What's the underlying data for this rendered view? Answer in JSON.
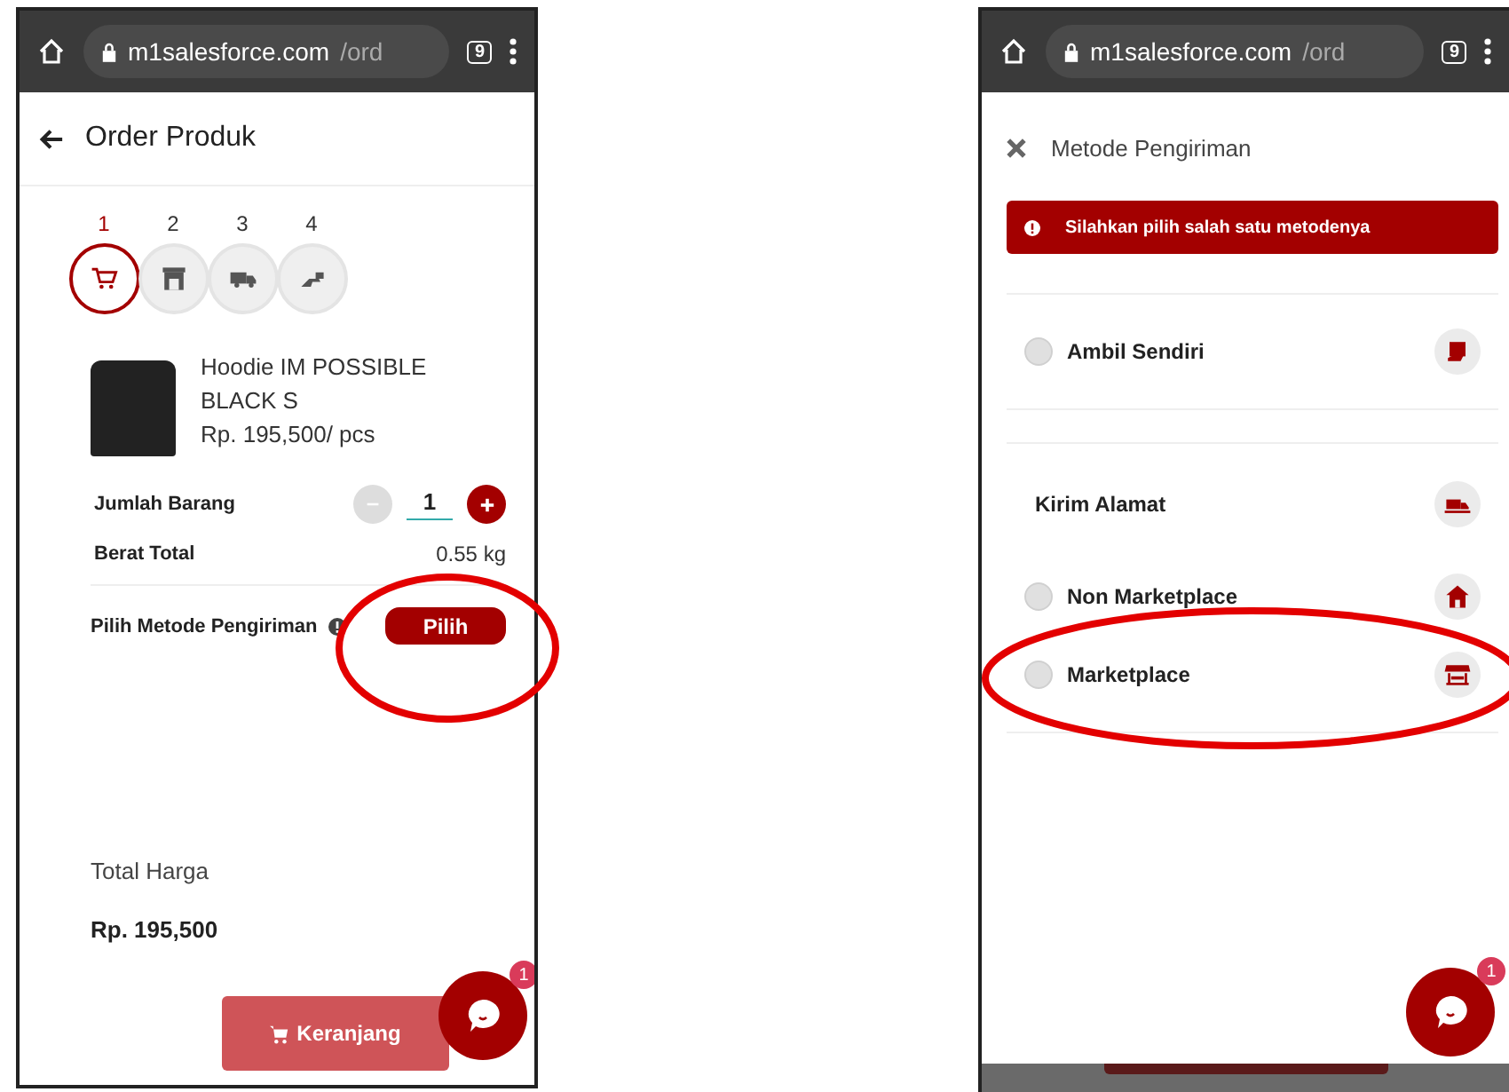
{
  "order_screen": {
    "browser": {
      "url_host": "m1salesforce.com",
      "url_path": "/ord",
      "tab_count": "9"
    },
    "title": "Order Produk",
    "steps": [
      {
        "number": "1",
        "selected": true
      },
      {
        "number": "2",
        "selected": false
      },
      {
        "number": "3",
        "selected": false
      },
      {
        "number": "4",
        "selected": false
      }
    ],
    "product": {
      "name": "Hoodie IM POSSIBLE BLACK S",
      "price": "Rp. 195,500/ pcs"
    },
    "quantity": {
      "label": "Jumlah Barang",
      "value": "1"
    },
    "weight": {
      "label": "Berat Total",
      "value": "0.55 kg"
    },
    "shipping": {
      "label": "Pilih Metode Pengiriman",
      "button": "Pilih"
    },
    "total": {
      "label": "Total Harga",
      "value": "Rp. 195,500"
    },
    "cart_button": "Keranjang",
    "chat_badge": "1"
  },
  "shipping_dialog": {
    "browser": {
      "url_host": "m1salesforce.com",
      "url_path": "/ord",
      "tab_count": "9"
    },
    "title": "Metode Pengiriman",
    "alert": "Silahkan pilih salah satu metodenya",
    "options": [
      {
        "kind": "radio",
        "label": "Ambil Sendiri",
        "selected": false
      },
      {
        "kind": "group",
        "label": "Kirim Alamat"
      },
      {
        "kind": "radio",
        "label": "Non Marketplace",
        "selected": false
      },
      {
        "kind": "radio",
        "label": "Marketplace",
        "selected": false
      }
    ],
    "chat_badge": "1"
  }
}
